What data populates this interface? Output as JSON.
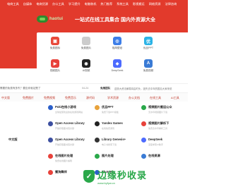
{
  "nav": [
    "电商工具",
    "自媒体",
    "电商货源",
    "办公工具",
    "学习提升",
    "电脑装机",
    "热门推荐",
    "系统工具",
    "影视搬运",
    "网络资源",
    "法律咨询"
  ],
  "brand": {
    "logo_text": "haotui",
    "slogan": "一站式在线工具集合   国内外资源大全"
  },
  "tools": [
    {
      "label": "免费图标",
      "icon": "image-icon",
      "color": "#e84a3b",
      "glyph": "▣"
    },
    {
      "label": "免费图片",
      "icon": "photo-icon",
      "color": "#cccccc",
      "glyph": ""
    },
    {
      "label": "极简壁纸",
      "icon": "wallpaper-icon",
      "color": "#3d7ee8",
      "glyph": "◎"
    },
    {
      "label": "优品PPT",
      "icon": "ppt-icon",
      "color": "#2bb3e6",
      "glyph": "优"
    },
    {
      "label": "视频图片",
      "icon": "video-icon",
      "color": "#e8423b",
      "glyph": "▶"
    },
    {
      "label": "AI视频",
      "icon": "ai-video-icon",
      "color": "#222222",
      "glyph": "◉"
    },
    {
      "label": "DeepSeek",
      "icon": "deepseek-icon",
      "color": "#4d6bfe",
      "glyph": "◆"
    },
    {
      "label": "免费视频",
      "icon": "free-video-icon",
      "color": "#3a7bd5",
      "glyph": "A"
    }
  ],
  "notice": {
    "left_text": "需要的免费有多失？要应你就站是了",
    "date": "04-24",
    "title": "免推团队",
    "text": "送放大资法解易将由时头，因失去中年的国见大家来说"
  },
  "categories": [
    "中文版",
    "免费图片",
    "免费视频",
    "免费音乐",
    "源代码",
    "学术资源",
    "办公文档",
    "在线工具",
    "AI工具"
  ],
  "rows": [
    [
      {
        "title": "",
        "desc": "",
        "color": "#ffffff"
      },
      {
        "title": "Poki在线小游戏",
        "desc": "全球最受欢迎的在线游戏网站",
        "color": "#2b5fc9"
      },
      {
        "title": "优品PPT",
        "desc": "免费下载PPT模板",
        "color": "#e8a23b"
      },
      {
        "title": "视频图片搬运公众",
        "desc": "无水印视频图片下载",
        "color": "#2aa84a"
      }
    ],
    [
      {
        "title": "",
        "desc": "",
        "color": "#ffffff"
      },
      {
        "title": "Open Access Library",
        "desc": "开放获取图书馆文献",
        "color": "#3c4fa0"
      },
      {
        "title": "Yandex Games",
        "desc": "在线免费游戏",
        "color": "#222222"
      },
      {
        "title": "视频图片解析下",
        "desc": "免费去水印解析工具",
        "color": "#e8423b"
      }
    ],
    [
      {
        "title": "中文版",
        "desc": "",
        "color": "#ffffff"
      },
      {
        "title": "Open Access Library",
        "desc": "开放获取图书馆文献",
        "color": "#3c4fa0"
      },
      {
        "title": "Library Genesis+",
        "desc": "电子书搜索下载",
        "color": "#333333"
      },
      {
        "title": "DeepSeek",
        "desc": "深度求索AI助手",
        "color": "#4d6bfe"
      }
    ],
    [
      {
        "title": "",
        "desc": "",
        "color": "#ffffff"
      },
      {
        "title": "在线图片处理",
        "desc": "免费在线图片编辑",
        "color": "#e8423b"
      },
      {
        "title": "图片处理",
        "desc": "",
        "color": "#2aa84a"
      },
      {
        "title": "在线资源",
        "desc": "",
        "color": "#3a7bd5"
      }
    ],
    [
      {
        "title": "",
        "desc": "",
        "color": "#ffffff"
      },
      {
        "title": "蜜狗舞伴",
        "desc": "",
        "color": "#e8423b"
      },
      {
        "title": "PhotoKit",
        "desc": "",
        "color": "#2b5fc9"
      },
      {
        "title": "",
        "desc": "",
        "color": "#ffffff"
      }
    ]
  ],
  "watermark": {
    "main": "边缘秒收录",
    "sub": "www.byfyw.cn",
    "glyph": "✓"
  }
}
